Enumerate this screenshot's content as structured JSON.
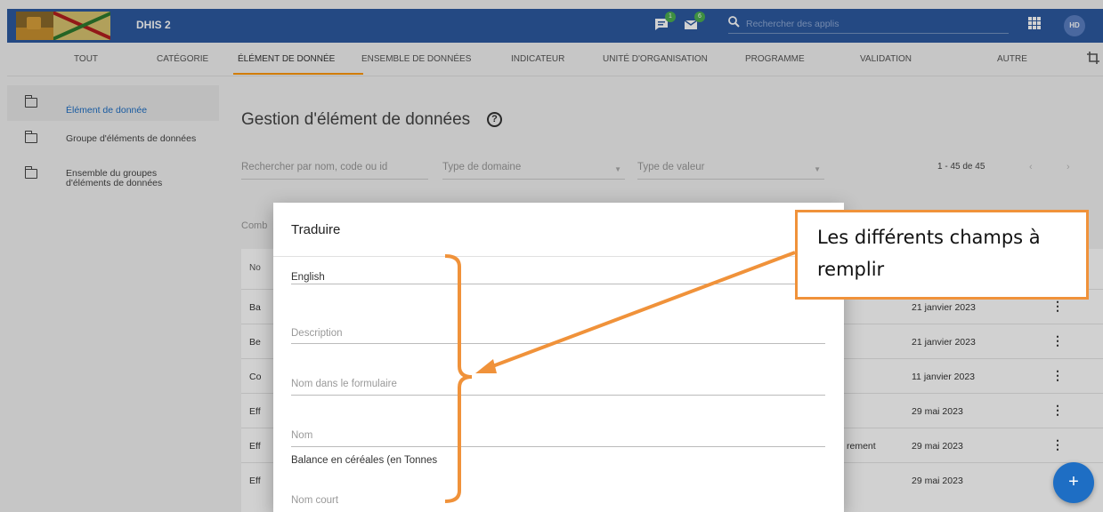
{
  "header": {
    "app_title": "DHIS 2",
    "messages_badge": "1",
    "interpretations_badge": "6",
    "search_placeholder": "Rechercher des applis",
    "avatar_initials": "HD"
  },
  "tabs": [
    {
      "label": "Tout"
    },
    {
      "label": "Catégorie"
    },
    {
      "label": "Élément de donnée",
      "active": true
    },
    {
      "label": "Ensemble de données"
    },
    {
      "label": "Indicateur"
    },
    {
      "label": "Unité d'organisation"
    },
    {
      "label": "Programme"
    },
    {
      "label": "Validation"
    },
    {
      "label": "Autre"
    }
  ],
  "sidebar": {
    "items": [
      {
        "label": "Élément de donnée",
        "active": true
      },
      {
        "label": "Groupe d'éléments de données"
      },
      {
        "label": "Ensemble du groupes d'éléments de données"
      }
    ]
  },
  "main": {
    "title": "Gestion d'élément de données",
    "filters": {
      "search_placeholder": "Rechercher par nom, code ou id",
      "domain_type": "Type de domaine",
      "value_type": "Type de valeur",
      "combo_partial": "Comb"
    },
    "pager": {
      "range": "1 - 45 de 45",
      "prev": "‹",
      "next": "›"
    },
    "table": {
      "header_partial": "No",
      "rows": [
        {
          "name_partial": "Ba",
          "extra": "",
          "date": "21 janvier 2023"
        },
        {
          "name_partial": "Be",
          "extra": "",
          "date": "21 janvier 2023"
        },
        {
          "name_partial": "Co",
          "extra": "",
          "date": "11 janvier 2023"
        },
        {
          "name_partial": "Eff",
          "extra": "",
          "date": "29 mai 2023"
        },
        {
          "name_partial": "Eff",
          "extra": "rement",
          "date": "29 mai 2023"
        },
        {
          "name_partial": "Eff",
          "extra": "",
          "date": "29 mai 2023"
        }
      ]
    },
    "fab_label": "+"
  },
  "dialog": {
    "title": "Traduire",
    "language": "English",
    "fields": [
      {
        "label": "Description",
        "value": ""
      },
      {
        "label": "Nom dans le formulaire",
        "value": ""
      },
      {
        "label": "Nom",
        "value": "Balance en céréales (en Tonnes"
      },
      {
        "label": "Nom court",
        "value": ""
      }
    ]
  },
  "annotation": {
    "text": "Les différents champs à remplir",
    "color": "#f0923a"
  },
  "colors": {
    "header_bg": "#2c5aa0",
    "active_tab_underline": "#ff9800",
    "sidebar_active_text": "#1e6ec4",
    "fab_bg": "#1e6ec4",
    "badge_bg": "#4caf50"
  }
}
